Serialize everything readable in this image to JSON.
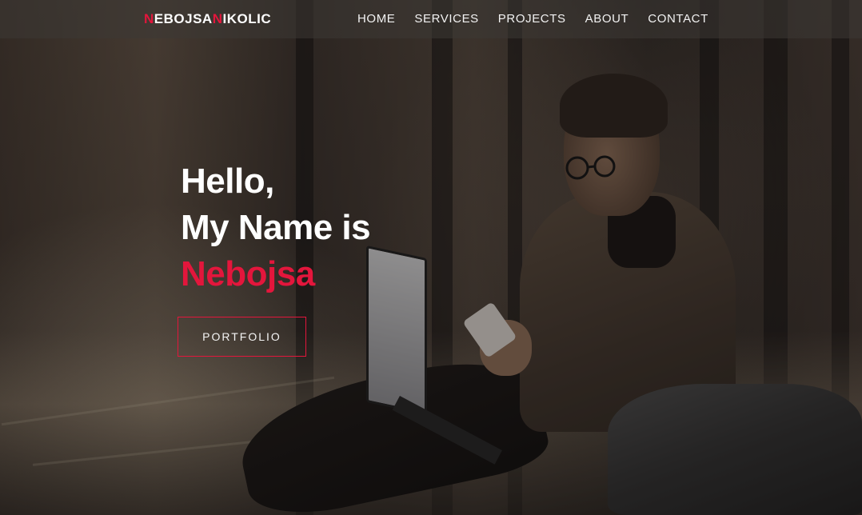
{
  "brand": {
    "logo_part1": "N",
    "logo_part2": "EBOJSA",
    "logo_part3": "N",
    "logo_part4": "IKOLIC",
    "accent_color": "#e3163c"
  },
  "nav": {
    "items": [
      {
        "label": "HOME"
      },
      {
        "label": "SERVICES"
      },
      {
        "label": "PROJECTS"
      },
      {
        "label": "ABOUT"
      },
      {
        "label": "CONTACT"
      }
    ]
  },
  "hero": {
    "line1": "Hello,",
    "line2": "My Name is",
    "name": "Nebojsa",
    "cta_label": "PORTFOLIO"
  }
}
